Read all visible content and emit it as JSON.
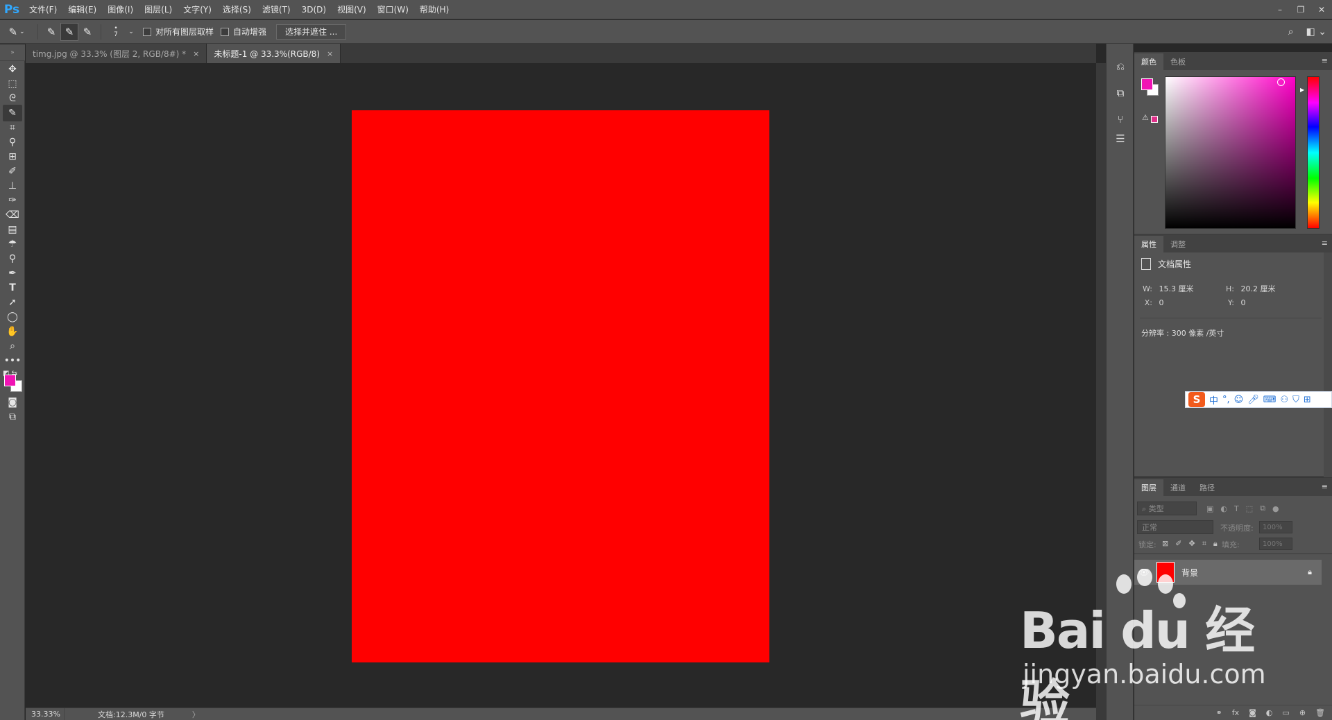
{
  "app": {
    "logo": "Ps"
  },
  "menu": [
    "文件(F)",
    "编辑(E)",
    "图像(I)",
    "图层(L)",
    "文字(Y)",
    "选择(S)",
    "滤镜(T)",
    "3D(D)",
    "视图(V)",
    "窗口(W)",
    "帮助(H)"
  ],
  "window_controls": {
    "minimize": "–",
    "restore": "❐",
    "close": "✕"
  },
  "options": {
    "brush_size": "7",
    "sample_all_layers": "对所有图层取样",
    "auto_enhance": "自动增强",
    "select_mask": "选择并遮住 ..."
  },
  "tabs": [
    {
      "label": "timg.jpg @ 33.3% (图层 2, RGB/8#) *",
      "close": "×"
    },
    {
      "label": "未标题-1 @ 33.3%(RGB/8)",
      "close": "×"
    }
  ],
  "document": {
    "fill_color": "#ff0000"
  },
  "status": {
    "zoom": "33.33%",
    "doc_info": "文档:12.3M/0 字节",
    "arrow": "〉"
  },
  "colors": {
    "foreground": "#f014b4",
    "background": "#ffffff",
    "accent": "#31a8ff"
  },
  "color_panel": {
    "tabs": [
      "颜色",
      "色板"
    ]
  },
  "properties_panel": {
    "tabs": [
      "属性",
      "调整"
    ],
    "title": "文档属性",
    "w_label": "W:",
    "w_value": "15.3 厘米",
    "h_label": "H:",
    "h_value": "20.2 厘米",
    "x_label": "X:",
    "x_value": "0",
    "y_label": "Y:",
    "y_value": "0",
    "resolution": "分辨率 : 300 像素 /英寸"
  },
  "ime": {
    "logo": "S",
    "mode": "中",
    "punct": "°,"
  },
  "layers_panel": {
    "tabs": [
      "图层",
      "通道",
      "路径"
    ],
    "filter_placeholder": "⌕ 类型",
    "blend_mode": "正常",
    "opacity_label": "不透明度:",
    "opacity_value": "100%",
    "lock_label": "锁定:",
    "fill_label": "填充:",
    "fill_value": "100%",
    "layers": [
      {
        "name": "背景",
        "color": "#ff0000"
      }
    ]
  },
  "watermark": {
    "brand": "Bai du 经验",
    "url": "jingyan.baidu.com"
  }
}
